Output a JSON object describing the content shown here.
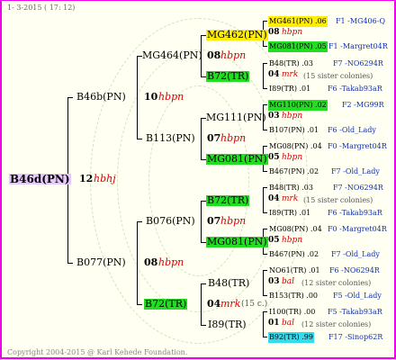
{
  "header": "1-  3-2015 ( 17: 12)",
  "footer": "Copyright 2004-2015 @ Karl Kehede Foundation.",
  "root": {
    "name": "B46d(PN)",
    "num": "12",
    "tag": "hbhj",
    "color": "#e6c8ff"
  },
  "g1": [
    {
      "name": "B46b(PN)",
      "num": "10",
      "tag": "hbpn"
    },
    {
      "name": "B077(PN)",
      "num": "08",
      "tag": "hbpn"
    }
  ],
  "g2": [
    {
      "name": "MG464(PN)",
      "num": "08",
      "tag": "hbpn"
    },
    {
      "name": "B113(PN)",
      "num": "07",
      "tag": "hbpn"
    },
    {
      "name": "B076(PN)",
      "num": "07",
      "tag": "hbpn"
    },
    {
      "name": "B72(TR)",
      "num": "04",
      "tag": "mrk",
      "extra": "(15 c.)",
      "color": "#22dd22"
    }
  ],
  "g3": [
    {
      "name": "MG462(PN)",
      "num": "08",
      "tag": "hbpn",
      "color": "#ffee00"
    },
    {
      "name": "B72(TR)",
      "num": "04",
      "tag": "mrk",
      "extra": "(15 sister colonies)",
      "color": "#22dd22"
    },
    {
      "name": "MG111(PN)",
      "num": "03",
      "tag": "hbpn"
    },
    {
      "name": "MG081(PN)",
      "num": "05",
      "tag": "hbpn",
      "color": "#22dd22"
    },
    {
      "name": "B72(TR)",
      "num": "04",
      "tag": "mrk",
      "extra": "(15 sister colonies)",
      "color": "#22dd22"
    },
    {
      "name": "MG081(PN)",
      "num": "05",
      "tag": "hbpn",
      "color": "#22dd22"
    },
    {
      "name": "B48(TR)",
      "num": "03",
      "tag": "bal",
      "extra": "(12 sister colonies)"
    },
    {
      "name": "I89(TR)",
      "num": "01",
      "tag": "bal",
      "extra": "(12 sister colonies)"
    }
  ],
  "g4": [
    {
      "name": "MG461(PN) .06",
      "id": "F1 -MG406-Q",
      "color": "#ffee00"
    },
    {
      "name": "MG081(PN) .05",
      "id": "F1 -Margret04R",
      "color": "#22dd22"
    },
    {
      "name": "B48(TR) .03",
      "id": "F7 -NO6294R"
    },
    {
      "name": "I89(TR) .01",
      "id": "F6 -Takab93aR"
    },
    {
      "name": "MG110(PN) .02",
      "id": "F2 -MG99R",
      "color": "#22dd22"
    },
    {
      "name": "B107(PN) .01",
      "id": "F6 -Old_Lady"
    },
    {
      "name": "MG08(PN) .04",
      "id": "F0 -Margret04R"
    },
    {
      "name": "B467(PN) .02",
      "id": "F7 -Old_Lady"
    },
    {
      "name": "B48(TR) .03",
      "id": "F7 -NO6294R"
    },
    {
      "name": "I89(TR) .01",
      "id": "F6 -Takab93aR"
    },
    {
      "name": "MG08(PN) .04",
      "id": "F0 -Margret04R"
    },
    {
      "name": "B467(PN) .02",
      "id": "F7 -Old_Lady"
    },
    {
      "name": "NO61(TR) .01",
      "id": "F6 -NO6294R"
    },
    {
      "name": "B153(TR) .00",
      "id": "F5 -Old_Lady"
    },
    {
      "name": "I100(TR) .00",
      "id": "F5 -Takab93aR"
    },
    {
      "name": "B92(TR) .99",
      "id": "F17 -Sinop62R",
      "color": "#33ddee"
    }
  ]
}
